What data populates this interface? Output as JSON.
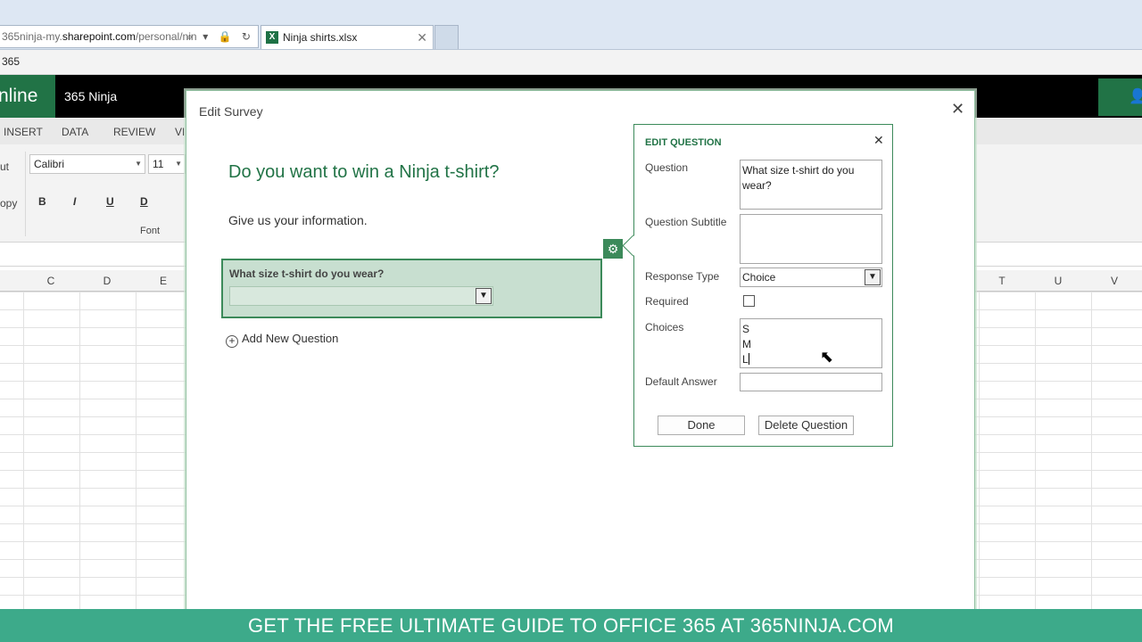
{
  "browser": {
    "address_prefix": "365ninja-my.",
    "address_domain": "sharepoint.com",
    "address_suffix": "/personal/nin",
    "address_icons": "⌕ ▾ 🔒 ↻",
    "tab_title": "Ninja shirts.xlsx",
    "tab_close": "✕",
    "favorites_text": "365"
  },
  "excel": {
    "app_name": "nline",
    "owner": "365 Ninja",
    "share_icon": "person-add-icon",
    "ribbon_tabs": [
      "INSERT",
      "DATA",
      "REVIEW",
      "VI"
    ],
    "ribbon": {
      "cut_label": "ut",
      "copy_label": "opy",
      "font_name": "Calibri",
      "font_size": "11",
      "bold": "B",
      "italic": "I",
      "underline": "U",
      "double_underline": "D",
      "group_label": "Font"
    },
    "columns_left": [
      "C",
      "D",
      "E"
    ],
    "columns_right": [
      "T",
      "U",
      "V"
    ]
  },
  "modal": {
    "title": "Edit Survey",
    "close": "✕",
    "survey_title": "Do you want to win a Ninja t-shirt?",
    "survey_description": "Give us your information.",
    "question_text": "What size t-shirt do you wear?",
    "add_question": "Add New Question"
  },
  "edit_question": {
    "heading": "EDIT QUESTION",
    "close": "✕",
    "question_label": "Question",
    "question_value": "What size t-shirt do you wear?",
    "subtitle_label": "Question Subtitle",
    "subtitle_value": "",
    "response_type_label": "Response Type",
    "response_type_value": "Choice",
    "required_label": "Required",
    "required_checked": false,
    "choices_label": "Choices",
    "choices": [
      "S",
      "M",
      "L"
    ],
    "default_answer_label": "Default Answer",
    "default_answer_value": "",
    "done_label": "Done",
    "delete_label": "Delete Question"
  },
  "banner": {
    "text": "GET THE FREE ULTIMATE GUIDE TO OFFICE 365 AT 365NINJA.COM"
  },
  "colors": {
    "excel_green": "#217346",
    "panel_border": "#3c8a5a",
    "question_highlight": "#c8dfd0",
    "banner": "#3daa8a"
  }
}
